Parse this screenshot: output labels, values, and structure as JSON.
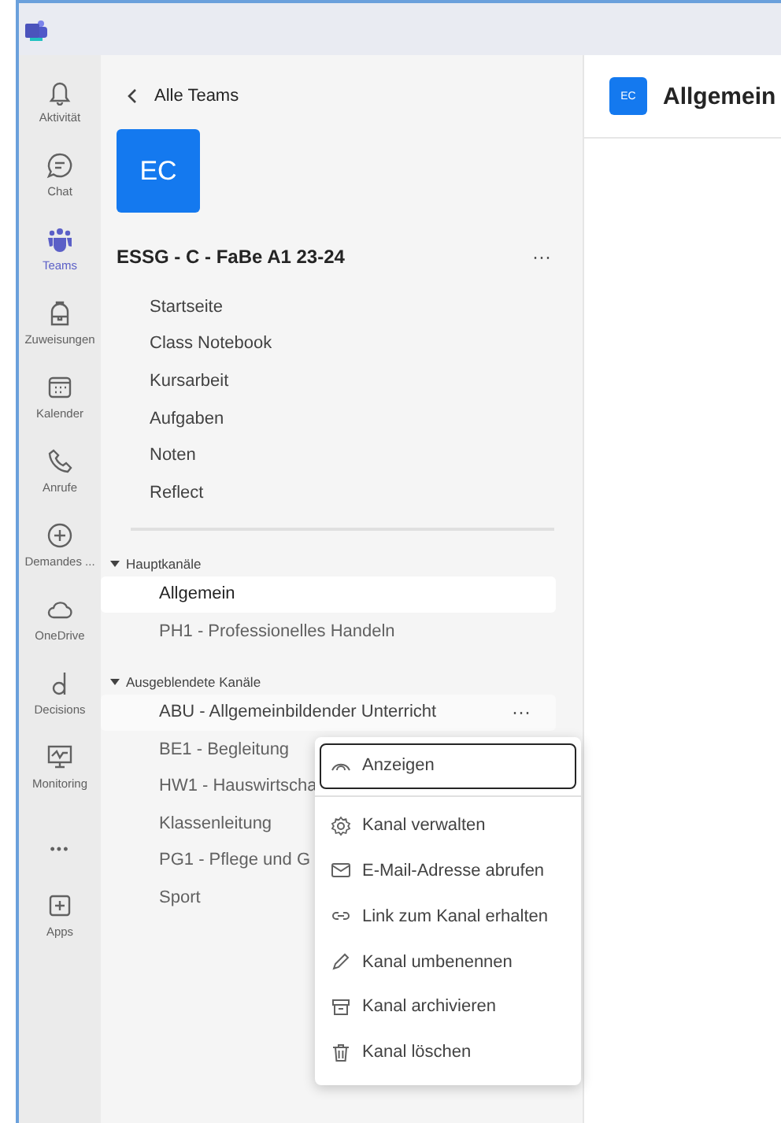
{
  "rail": [
    {
      "label": "Aktivität",
      "selected": false
    },
    {
      "label": "Chat",
      "selected": false
    },
    {
      "label": "Teams",
      "selected": true
    },
    {
      "label": "Zuweisungen",
      "selected": false
    },
    {
      "label": "Kalender",
      "selected": false
    },
    {
      "label": "Anrufe",
      "selected": false
    },
    {
      "label": "Demandes ...",
      "selected": false
    },
    {
      "label": "OneDrive",
      "selected": false
    },
    {
      "label": "Decisions",
      "selected": false
    },
    {
      "label": "Monitoring",
      "selected": false
    },
    {
      "label": "Apps",
      "selected": false
    }
  ],
  "rail_more": "•••",
  "panel": {
    "back": "Alle Teams",
    "avatar": "EC",
    "team_name": "ESSG - C - FaBe A1 23-24",
    "team_more": "···",
    "tabs": [
      "Startseite",
      "Class Notebook",
      "Kursarbeit",
      "Aufgaben",
      "Noten",
      "Reflect"
    ],
    "sections": [
      {
        "title": "Hauptkanäle",
        "expanded": true,
        "channels": [
          {
            "name": "Allgemein",
            "selected": true,
            "hovered": false
          },
          {
            "name": "PH1 - Professionelles Handeln",
            "selected": false,
            "hovered": false
          }
        ]
      },
      {
        "title": "Ausgeblendete Kanäle",
        "expanded": true,
        "channels": [
          {
            "name": "ABU - Allgemeinbildender Unterricht",
            "selected": false,
            "hovered": true,
            "more": "···"
          },
          {
            "name": "BE1 - Begleitung",
            "selected": false,
            "hovered": false
          },
          {
            "name": "HW1 - Hauswirtscha",
            "selected": false,
            "hovered": false
          },
          {
            "name": "Klassenleitung",
            "selected": false,
            "hovered": false
          },
          {
            "name": "PG1 - Pflege und G",
            "selected": false,
            "hovered": false
          },
          {
            "name": "Sport",
            "selected": false,
            "hovered": false
          }
        ]
      }
    ]
  },
  "context_menu": [
    {
      "label": "Anzeigen",
      "focused": true
    },
    {
      "label": "Kanal verwalten",
      "focused": false
    },
    {
      "label": "E-Mail-Adresse abrufen",
      "focused": false
    },
    {
      "label": "Link zum Kanal erhalten",
      "focused": false
    },
    {
      "label": "Kanal umbenennen",
      "focused": false
    },
    {
      "label": "Kanal archivieren",
      "focused": false
    },
    {
      "label": "Kanal löschen",
      "focused": false
    }
  ],
  "main": {
    "avatar": "EC",
    "title": "Allgemein"
  }
}
